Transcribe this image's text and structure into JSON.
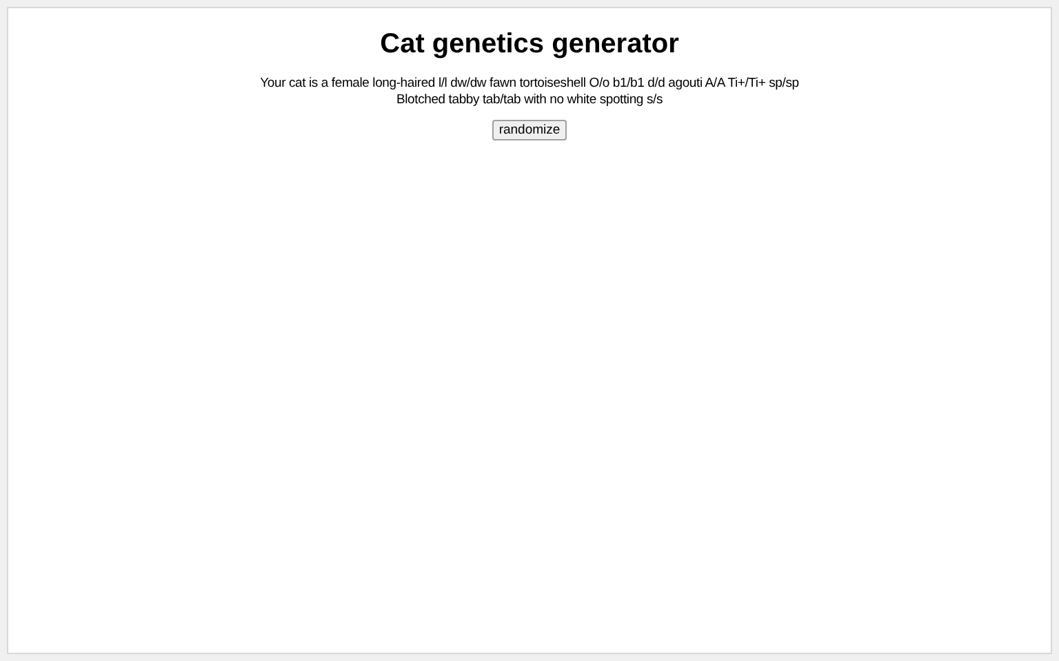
{
  "title": "Cat genetics generator",
  "description": "Your cat is a female long-haired l/l dw/dw fawn tortoiseshell O/o b1/b1 d/d agouti A/A Ti+/Ti+ sp/sp Blotched tabby tab/tab with no white spotting s/s",
  "button": "randomize"
}
